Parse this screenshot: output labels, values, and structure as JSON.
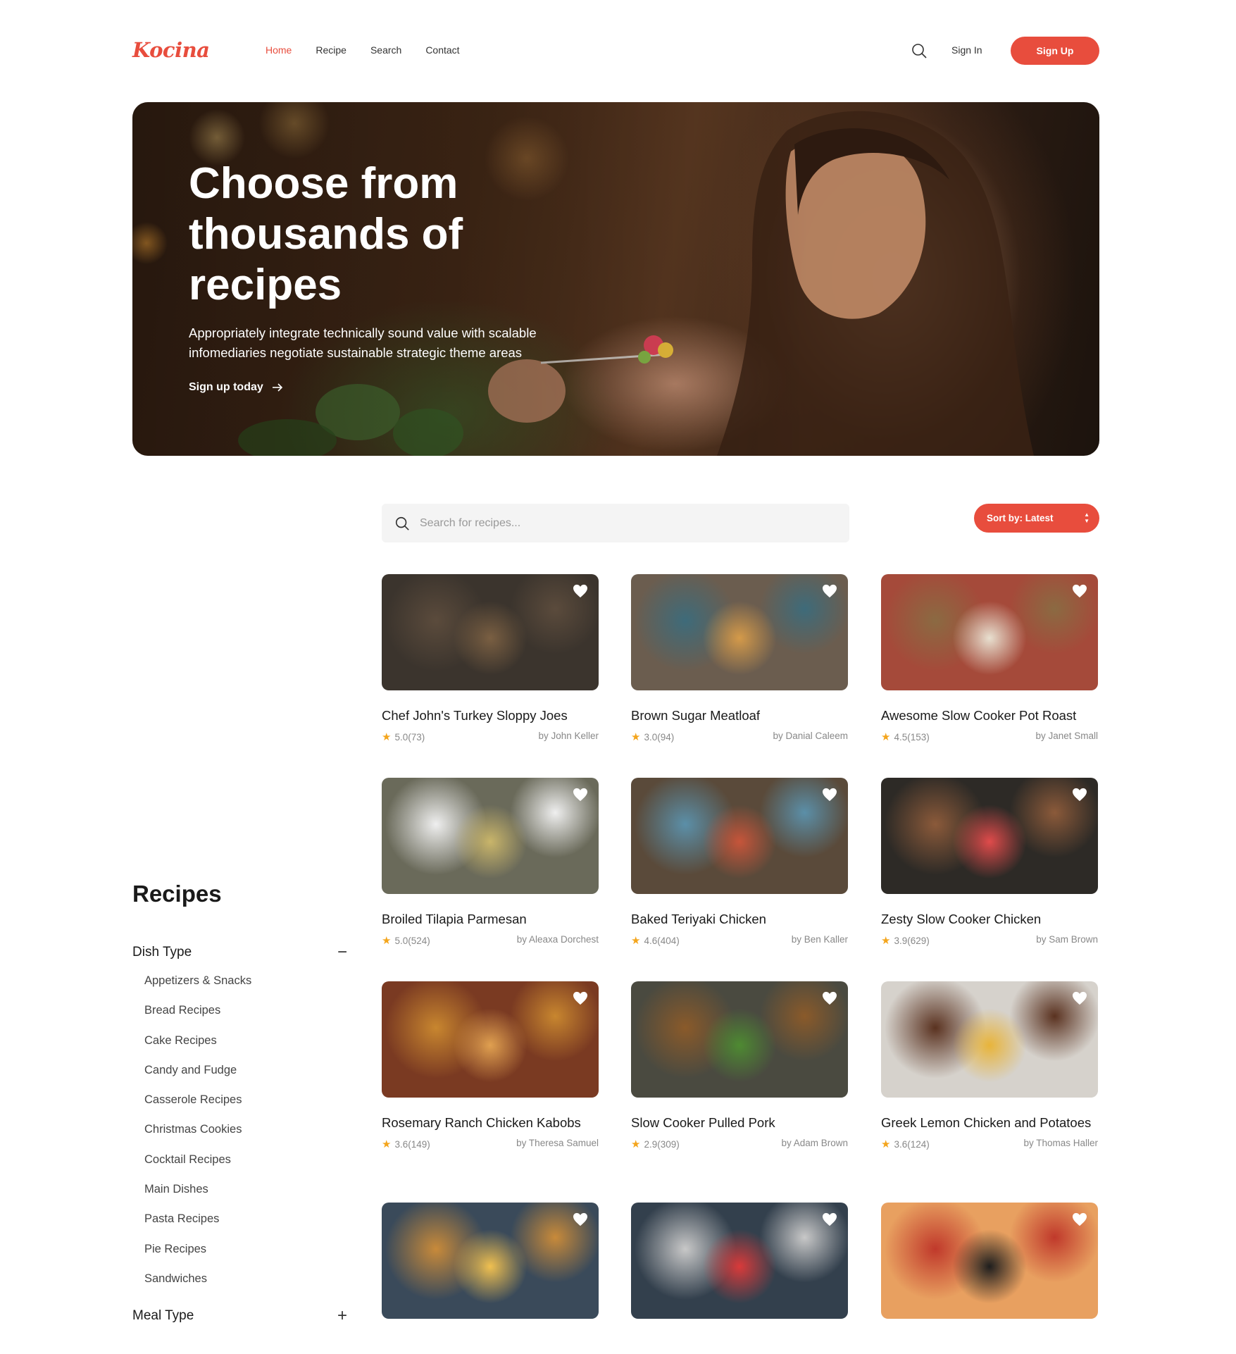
{
  "header": {
    "logo": "Kocina",
    "nav": [
      {
        "label": "Home",
        "active": true
      },
      {
        "label": "Recipe",
        "active": false
      },
      {
        "label": "Search",
        "active": false
      },
      {
        "label": "Contact",
        "active": false
      }
    ],
    "search_icon": "search-icon",
    "sign_in": "Sign In",
    "sign_up": "Sign Up"
  },
  "hero": {
    "title": "Choose from thousands of recipes",
    "subtitle": "Appropriately integrate technically sound value with scalable infomediaries negotiate sustainable strategic theme areas",
    "cta": "Sign up today"
  },
  "search": {
    "placeholder": "Search for recipes..."
  },
  "sort": {
    "label": "Sort by: Latest"
  },
  "sidebar": {
    "title": "Recipes",
    "groups": [
      {
        "label": "Dish Type",
        "toggle": "−",
        "items": [
          "Appetizers & Snacks",
          "Bread Recipes",
          "Cake Recipes",
          "Candy and Fudge",
          "Casserole Recipes",
          "Christmas Cookies",
          "Cocktail Recipes",
          "Main Dishes",
          "Pasta Recipes",
          "Pie Recipes",
          "Sandwiches"
        ]
      },
      {
        "label": "Meal Type",
        "toggle": "+"
      }
    ]
  },
  "recipes": [
    {
      "title": "Chef John's Turkey Sloppy Joes",
      "rating": "5.0(73)",
      "author": "by John Keller"
    },
    {
      "title": "Brown Sugar Meatloaf",
      "rating": "3.0(94)",
      "author": "by Danial Caleem"
    },
    {
      "title": "Awesome Slow Cooker Pot Roast",
      "rating": "4.5(153)",
      "author": "by Janet Small"
    },
    {
      "title": "Broiled Tilapia Parmesan",
      "rating": "5.0(524)",
      "author": "by Aleaxa Dorchest"
    },
    {
      "title": "Baked Teriyaki Chicken",
      "rating": "4.6(404)",
      "author": "by Ben Kaller"
    },
    {
      "title": "Zesty Slow Cooker Chicken",
      "rating": "3.9(629)",
      "author": "by Sam Brown"
    },
    {
      "title": "Rosemary Ranch Chicken Kabobs",
      "rating": "3.6(149)",
      "author": "by Theresa Samuel"
    },
    {
      "title": "Slow Cooker Pulled Pork",
      "rating": "2.9(309)",
      "author": "by Adam Brown"
    },
    {
      "title": "Greek Lemon Chicken and Potatoes",
      "rating": "3.6(124)",
      "author": "by Thomas Haller"
    },
    {
      "title": "",
      "rating": "",
      "author": ""
    },
    {
      "title": "",
      "rating": "",
      "author": ""
    },
    {
      "title": "",
      "rating": "",
      "author": ""
    }
  ],
  "colors": {
    "accent": "#e84d3d",
    "star": "#f4a51c"
  }
}
